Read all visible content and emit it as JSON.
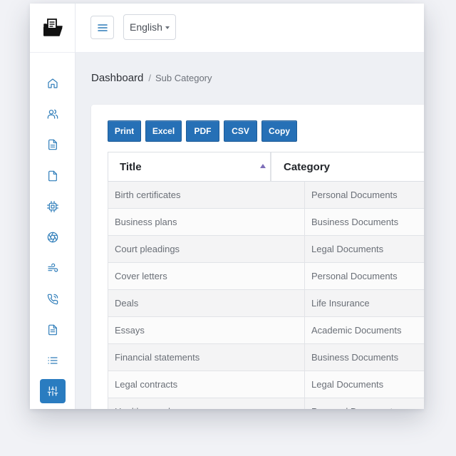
{
  "topbar": {
    "language": "English"
  },
  "breadcrumb": {
    "home": "Dashboard",
    "separator": "/",
    "current": "Sub Category"
  },
  "icons": {
    "logo": "folder-document-icon",
    "sidebar": [
      "home-icon",
      "users-icon",
      "file-text-icon",
      "file-icon",
      "cpu-chip-icon",
      "aperture-icon",
      "wind-icon",
      "phone-icon",
      "document-icon",
      "list-icon",
      "sliders-icon"
    ]
  },
  "colors": {
    "accent": "#2a7cc0",
    "button": "#2670b6"
  },
  "toolbar": {
    "buttons": [
      "Print",
      "Excel",
      "PDF",
      "CSV",
      "Copy"
    ]
  },
  "table": {
    "headers": [
      "Title",
      "Category"
    ],
    "rows": [
      [
        "Birth certificates",
        "Personal Documents"
      ],
      [
        "Business plans",
        "Business Documents"
      ],
      [
        "Court pleadings",
        "Legal Documents"
      ],
      [
        "Cover letters",
        "Personal Documents"
      ],
      [
        "Deals",
        "Life Insurance"
      ],
      [
        "Essays",
        "Academic Documents"
      ],
      [
        "Financial statements",
        "Business Documents"
      ],
      [
        "Legal contracts",
        "Legal Documents"
      ],
      [
        "Health records",
        "Personal Documents"
      ]
    ]
  }
}
